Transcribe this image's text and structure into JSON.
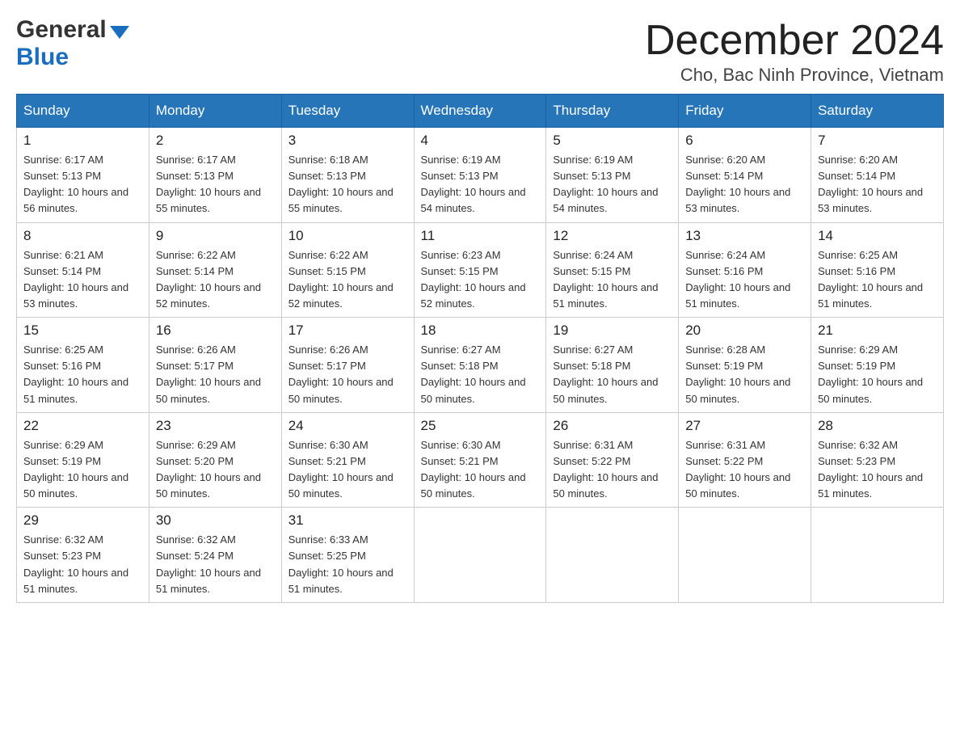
{
  "header": {
    "logo_general": "General",
    "logo_blue": "Blue",
    "month_title": "December 2024",
    "location": "Cho, Bac Ninh Province, Vietnam"
  },
  "weekdays": [
    "Sunday",
    "Monday",
    "Tuesday",
    "Wednesday",
    "Thursday",
    "Friday",
    "Saturday"
  ],
  "weeks": [
    [
      {
        "day": "1",
        "sunrise": "6:17 AM",
        "sunset": "5:13 PM",
        "daylight": "10 hours and 56 minutes."
      },
      {
        "day": "2",
        "sunrise": "6:17 AM",
        "sunset": "5:13 PM",
        "daylight": "10 hours and 55 minutes."
      },
      {
        "day": "3",
        "sunrise": "6:18 AM",
        "sunset": "5:13 PM",
        "daylight": "10 hours and 55 minutes."
      },
      {
        "day": "4",
        "sunrise": "6:19 AM",
        "sunset": "5:13 PM",
        "daylight": "10 hours and 54 minutes."
      },
      {
        "day": "5",
        "sunrise": "6:19 AM",
        "sunset": "5:13 PM",
        "daylight": "10 hours and 54 minutes."
      },
      {
        "day": "6",
        "sunrise": "6:20 AM",
        "sunset": "5:14 PM",
        "daylight": "10 hours and 53 minutes."
      },
      {
        "day": "7",
        "sunrise": "6:20 AM",
        "sunset": "5:14 PM",
        "daylight": "10 hours and 53 minutes."
      }
    ],
    [
      {
        "day": "8",
        "sunrise": "6:21 AM",
        "sunset": "5:14 PM",
        "daylight": "10 hours and 53 minutes."
      },
      {
        "day": "9",
        "sunrise": "6:22 AM",
        "sunset": "5:14 PM",
        "daylight": "10 hours and 52 minutes."
      },
      {
        "day": "10",
        "sunrise": "6:22 AM",
        "sunset": "5:15 PM",
        "daylight": "10 hours and 52 minutes."
      },
      {
        "day": "11",
        "sunrise": "6:23 AM",
        "sunset": "5:15 PM",
        "daylight": "10 hours and 52 minutes."
      },
      {
        "day": "12",
        "sunrise": "6:24 AM",
        "sunset": "5:15 PM",
        "daylight": "10 hours and 51 minutes."
      },
      {
        "day": "13",
        "sunrise": "6:24 AM",
        "sunset": "5:16 PM",
        "daylight": "10 hours and 51 minutes."
      },
      {
        "day": "14",
        "sunrise": "6:25 AM",
        "sunset": "5:16 PM",
        "daylight": "10 hours and 51 minutes."
      }
    ],
    [
      {
        "day": "15",
        "sunrise": "6:25 AM",
        "sunset": "5:16 PM",
        "daylight": "10 hours and 51 minutes."
      },
      {
        "day": "16",
        "sunrise": "6:26 AM",
        "sunset": "5:17 PM",
        "daylight": "10 hours and 50 minutes."
      },
      {
        "day": "17",
        "sunrise": "6:26 AM",
        "sunset": "5:17 PM",
        "daylight": "10 hours and 50 minutes."
      },
      {
        "day": "18",
        "sunrise": "6:27 AM",
        "sunset": "5:18 PM",
        "daylight": "10 hours and 50 minutes."
      },
      {
        "day": "19",
        "sunrise": "6:27 AM",
        "sunset": "5:18 PM",
        "daylight": "10 hours and 50 minutes."
      },
      {
        "day": "20",
        "sunrise": "6:28 AM",
        "sunset": "5:19 PM",
        "daylight": "10 hours and 50 minutes."
      },
      {
        "day": "21",
        "sunrise": "6:29 AM",
        "sunset": "5:19 PM",
        "daylight": "10 hours and 50 minutes."
      }
    ],
    [
      {
        "day": "22",
        "sunrise": "6:29 AM",
        "sunset": "5:19 PM",
        "daylight": "10 hours and 50 minutes."
      },
      {
        "day": "23",
        "sunrise": "6:29 AM",
        "sunset": "5:20 PM",
        "daylight": "10 hours and 50 minutes."
      },
      {
        "day": "24",
        "sunrise": "6:30 AM",
        "sunset": "5:21 PM",
        "daylight": "10 hours and 50 minutes."
      },
      {
        "day": "25",
        "sunrise": "6:30 AM",
        "sunset": "5:21 PM",
        "daylight": "10 hours and 50 minutes."
      },
      {
        "day": "26",
        "sunrise": "6:31 AM",
        "sunset": "5:22 PM",
        "daylight": "10 hours and 50 minutes."
      },
      {
        "day": "27",
        "sunrise": "6:31 AM",
        "sunset": "5:22 PM",
        "daylight": "10 hours and 50 minutes."
      },
      {
        "day": "28",
        "sunrise": "6:32 AM",
        "sunset": "5:23 PM",
        "daylight": "10 hours and 51 minutes."
      }
    ],
    [
      {
        "day": "29",
        "sunrise": "6:32 AM",
        "sunset": "5:23 PM",
        "daylight": "10 hours and 51 minutes."
      },
      {
        "day": "30",
        "sunrise": "6:32 AM",
        "sunset": "5:24 PM",
        "daylight": "10 hours and 51 minutes."
      },
      {
        "day": "31",
        "sunrise": "6:33 AM",
        "sunset": "5:25 PM",
        "daylight": "10 hours and 51 minutes."
      },
      null,
      null,
      null,
      null
    ]
  ]
}
